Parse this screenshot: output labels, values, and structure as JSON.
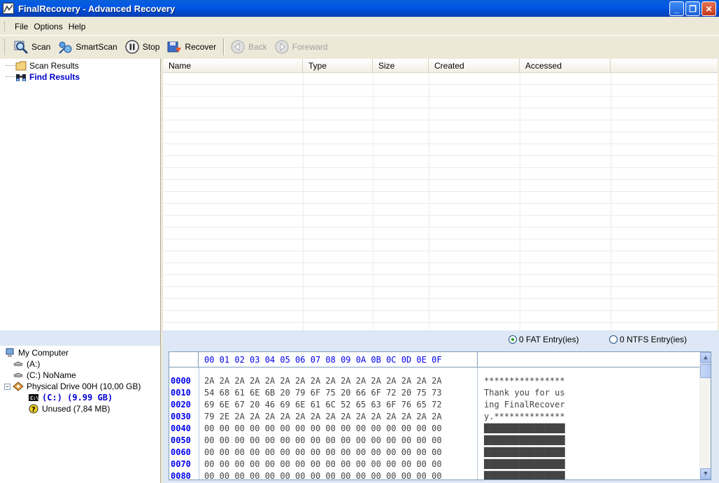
{
  "window": {
    "title": "FinalRecovery - Advanced Recovery",
    "minimize": "_",
    "maximize": "❐",
    "close": "✕"
  },
  "menu": [
    "File",
    "Options",
    "Help"
  ],
  "toolbar": {
    "scan": "Scan",
    "smartscan": "SmartScan",
    "stop": "Stop",
    "recover": "Recover",
    "back": "Back",
    "forward": "Foreward"
  },
  "results_tree": {
    "scan_results": "Scan Results",
    "find_results": "Find Results"
  },
  "list": {
    "columns": [
      "Name",
      "Type",
      "Size",
      "Created",
      "Accessed"
    ]
  },
  "drive_tree": {
    "my_computer": "My Computer",
    "a_drive": "(A:)",
    "c_drive": "(C:) NoName",
    "physical_drive": "Physical Drive 00H (10,00 GB)",
    "c_partition": "(C:)  (9.99 GB)",
    "unused": "Unused (7,84 MB)"
  },
  "entries": {
    "fat": "0 FAT Entry(ies)",
    "ntfs": "0 NTFS Entry(ies)"
  },
  "hex": {
    "header": "00 01 02 03 04 05 06 07 08 09 0A 0B 0C 0D 0E 0F",
    "rows": [
      {
        "addr": "0000",
        "bytes": "2A 2A 2A 2A 2A 2A 2A 2A 2A 2A 2A 2A 2A 2A 2A 2A",
        "ascii": "****************"
      },
      {
        "addr": "0010",
        "bytes": "54 68 61 6E 6B 20 79 6F 75 20 66 6F 72 20 75 73",
        "ascii": "Thank you for us"
      },
      {
        "addr": "0020",
        "bytes": "69 6E 67 20 46 69 6E 61 6C 52 65 63 6F 76 65 72",
        "ascii": "ing FinalRecover"
      },
      {
        "addr": "0030",
        "bytes": "79 2E 2A 2A 2A 2A 2A 2A 2A 2A 2A 2A 2A 2A 2A 2A",
        "ascii": "y.**************"
      },
      {
        "addr": "0040",
        "bytes": "00 00 00 00 00 00 00 00 00 00 00 00 00 00 00 00",
        "ascii": "████████████████"
      },
      {
        "addr": "0050",
        "bytes": "00 00 00 00 00 00 00 00 00 00 00 00 00 00 00 00",
        "ascii": "████████████████"
      },
      {
        "addr": "0060",
        "bytes": "00 00 00 00 00 00 00 00 00 00 00 00 00 00 00 00",
        "ascii": "████████████████"
      },
      {
        "addr": "0070",
        "bytes": "00 00 00 00 00 00 00 00 00 00 00 00 00 00 00 00",
        "ascii": "████████████████"
      },
      {
        "addr": "0080",
        "bytes": "00 00 00 00 00 00 00 00 00 00 00 00 00 00 00 00",
        "ascii": "████████████████"
      }
    ]
  },
  "colors": {
    "titlebar": "#0058e6",
    "hex_blue": "#0000ee",
    "panel_band": "#dde7f5"
  }
}
